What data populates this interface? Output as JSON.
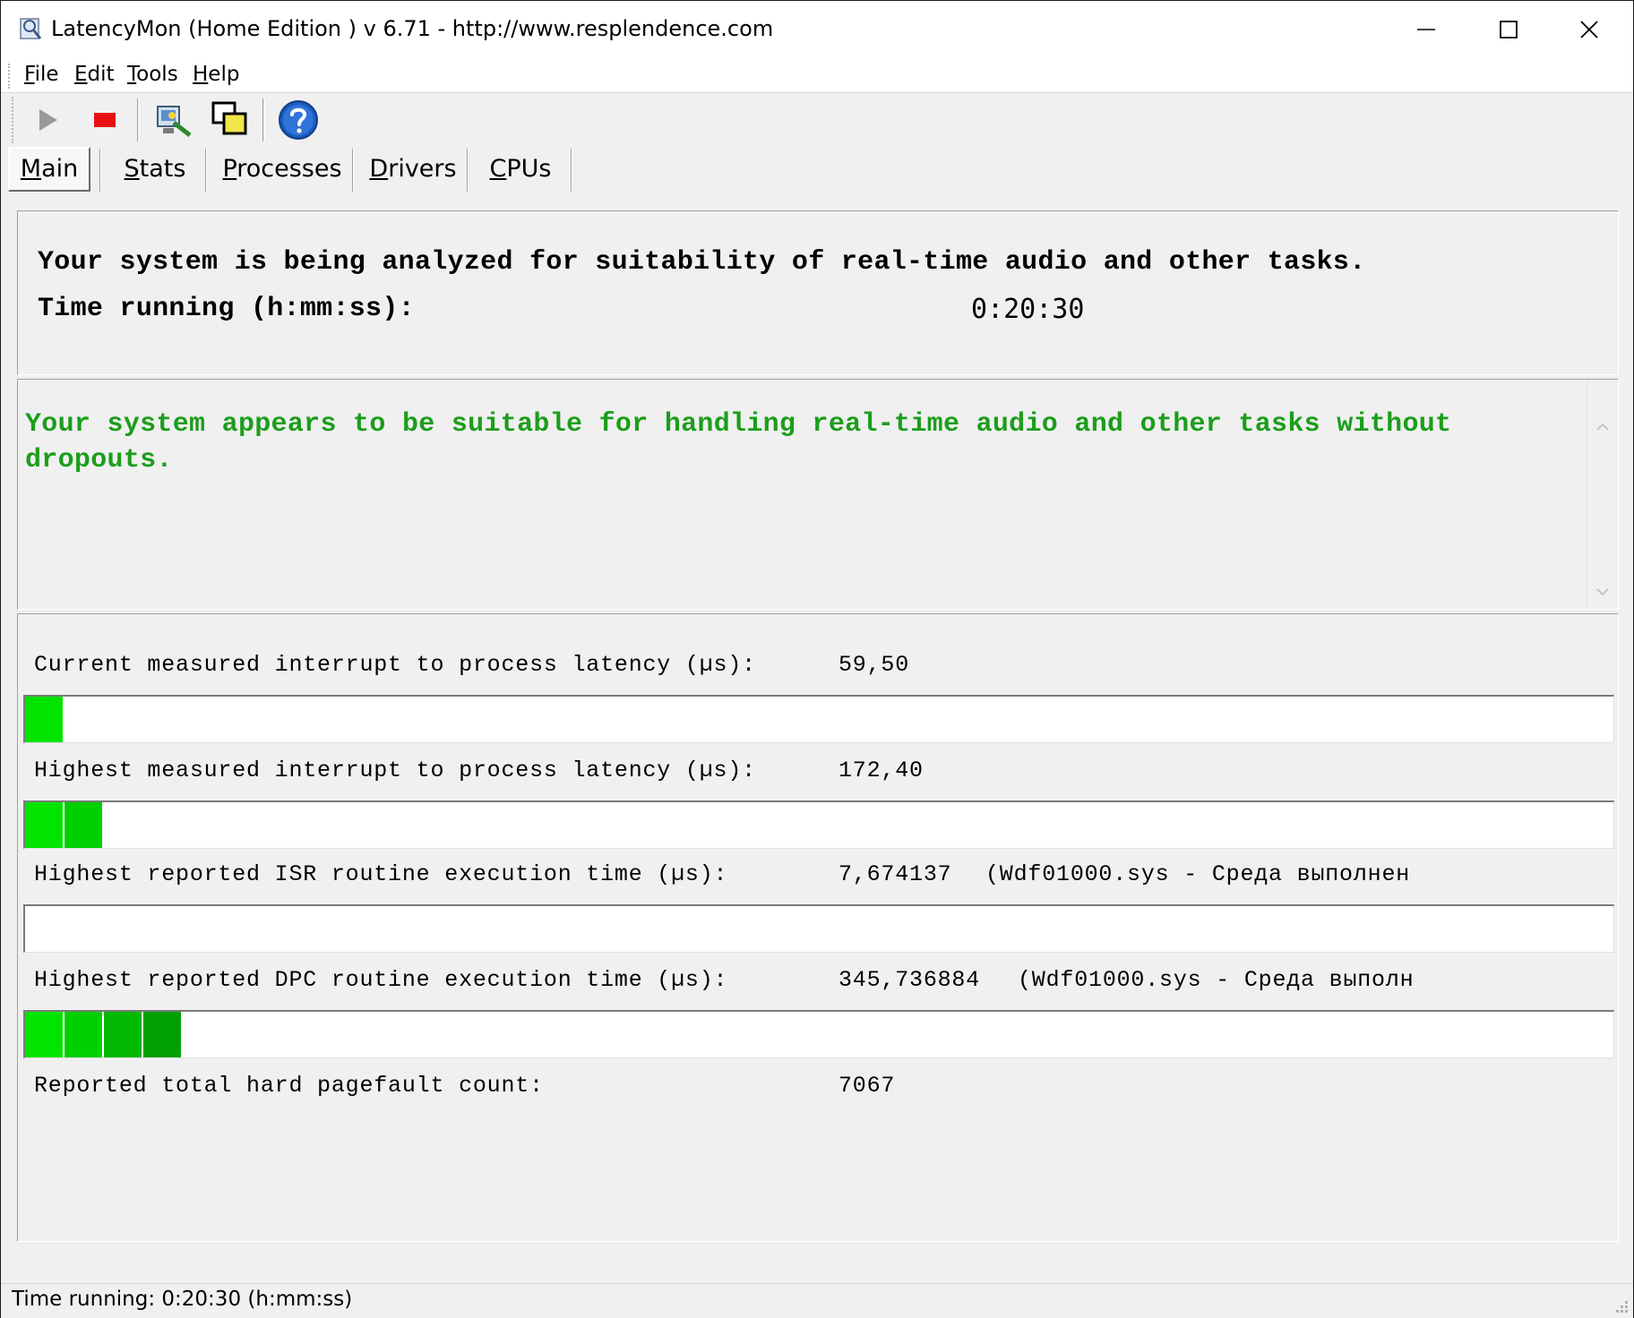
{
  "window": {
    "title": "LatencyMon  (Home Edition )  v 6.71 - http://www.resplendence.com"
  },
  "menu": [
    {
      "acc": "F",
      "rest": "ile"
    },
    {
      "acc": "E",
      "rest": "dit"
    },
    {
      "acc": "T",
      "rest": "ools"
    },
    {
      "acc": "H",
      "rest": "elp"
    }
  ],
  "toolbar": {
    "icons": [
      "play-icon",
      "stop-icon",
      "analyze-icon",
      "windows-icon",
      "help-icon"
    ],
    "colors": {
      "stop": "#e81010",
      "help": "#1e5bbf"
    }
  },
  "tabs": [
    {
      "acc": "M",
      "rest": "ain",
      "active": true
    },
    {
      "acc": "S",
      "rest": "tats",
      "active": false
    },
    {
      "acc": "P",
      "rest": "rocesses",
      "active": false
    },
    {
      "acc": "D",
      "rest": "rivers",
      "active": false
    },
    {
      "acc": "C",
      "rest": "PUs",
      "active": false
    }
  ],
  "analysis": {
    "line1": "Your system is being analyzed for suitability of real-time audio and other tasks.",
    "time_label": "Time running (h:mm:ss):",
    "time_value": "0:20:30"
  },
  "verdict": {
    "text": "Your system appears to be suitable for handling real-time audio and other tasks without dropouts.",
    "color": "#1b9e1b"
  },
  "metrics": {
    "current_latency": {
      "label": "Current measured interrupt to process latency (µs):",
      "value": "59,50",
      "level_blocks": 1
    },
    "highest_latency": {
      "label": "Highest measured interrupt to process latency (µs):",
      "value": "172,40",
      "level_blocks": 2
    },
    "isr": {
      "label": "Highest reported ISR routine execution time (µs):",
      "value": "7,674137",
      "driver": "(Wdf01000.sys - Среда выполнен",
      "level_blocks": 0
    },
    "dpc": {
      "label": "Highest reported DPC routine execution time (µs):",
      "value": "345,736884",
      "driver": "(Wdf01000.sys - Среда выполн",
      "level_blocks": 4
    },
    "pagefault": {
      "label": "Reported total hard pagefault count:",
      "value": "7067"
    }
  },
  "meter_colors": [
    "#00e400",
    "#00cf00",
    "#00b800",
    "#00a000"
  ],
  "statusbar": {
    "text": "Time running: 0:20:30  (h:mm:ss)"
  }
}
